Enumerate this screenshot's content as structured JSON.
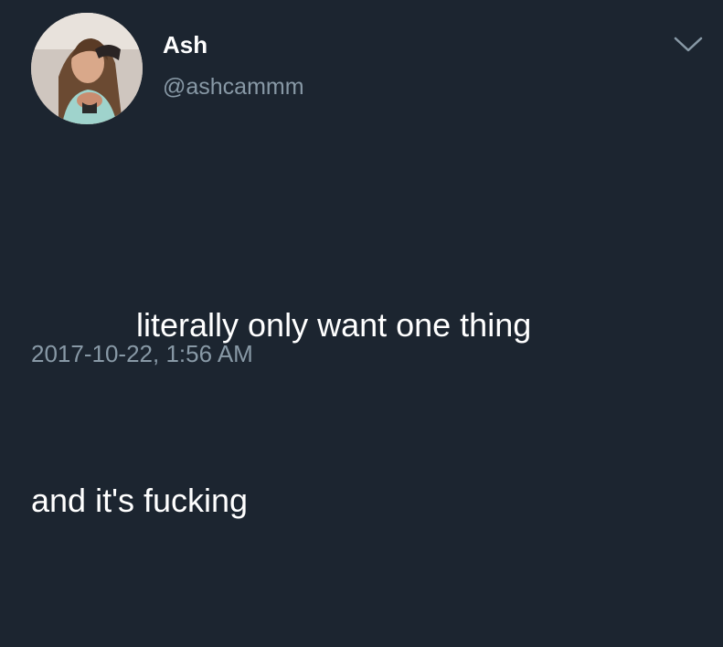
{
  "user": {
    "display_name": "Ash",
    "handle": "@ashcammm"
  },
  "tweet": {
    "line1": "literally only want one thing",
    "line2": "and it's fucking"
  },
  "timestamp": "2017-10-22, 1:56 AM",
  "icons": {
    "avatar": "profile-photo",
    "menu": "chevron-down-icon"
  },
  "colors": {
    "background": "#1c2530",
    "text": "#ffffff",
    "secondary_text": "#8899a6"
  }
}
